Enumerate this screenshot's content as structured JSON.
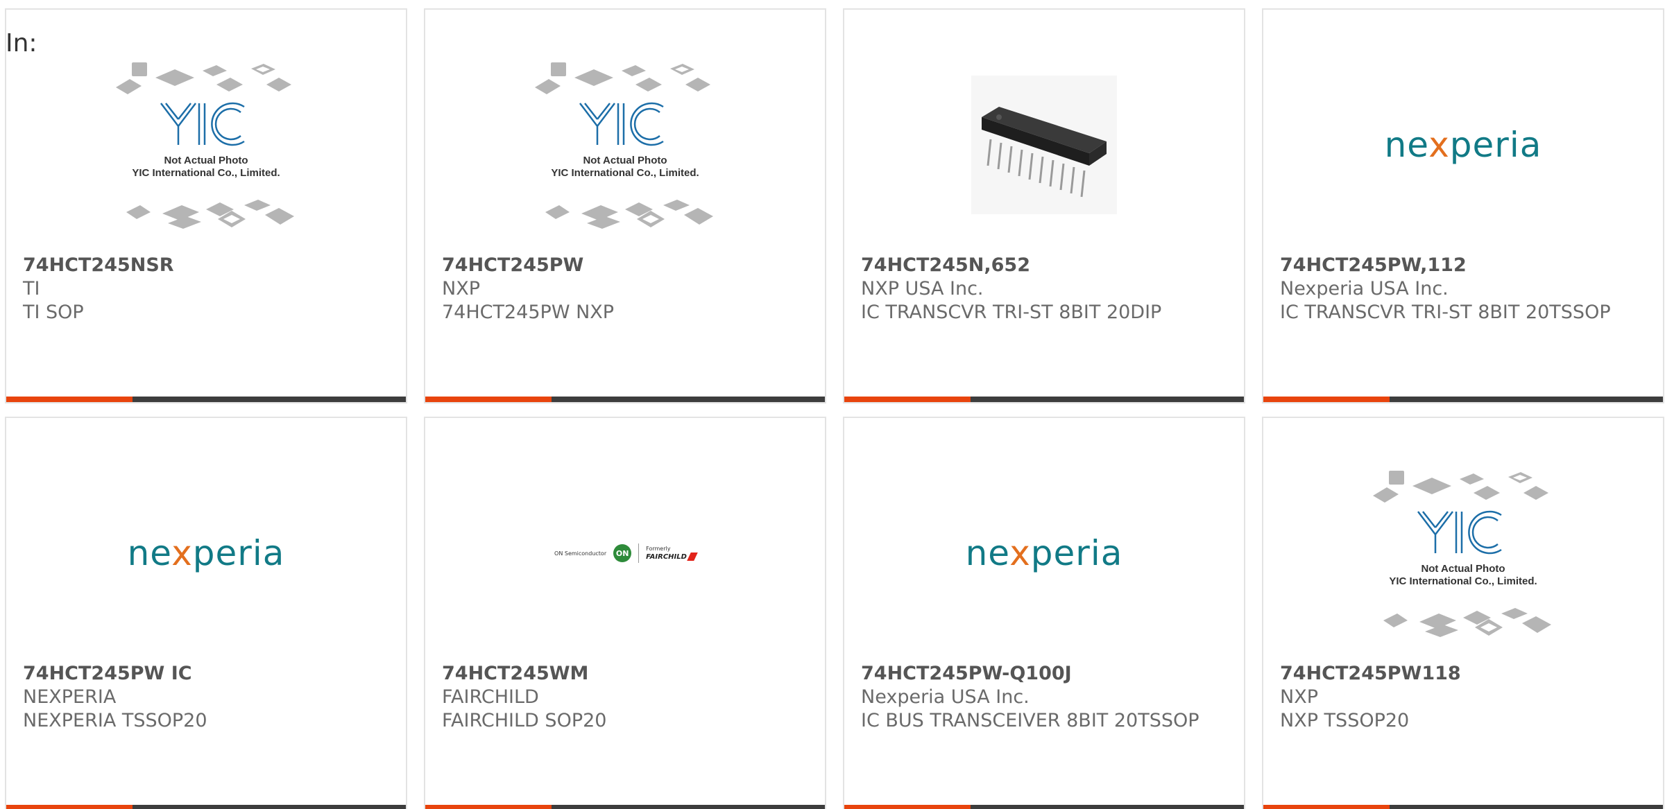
{
  "filter_label": "In:",
  "colors": {
    "card_border": "#e3e3e3",
    "bar_dark": "#3d3d3d",
    "bar_accent": "#e8440d",
    "nexperia_teal": "#117a86",
    "nexperia_orange": "#e36f1e"
  },
  "placeholder": {
    "line1": "Not Actual Photo",
    "line2": "YIC International Co., Limited.",
    "logo_text": "YIC"
  },
  "nexperia_logo": {
    "before": "ne",
    "x": "x",
    "after": "peria"
  },
  "fairchild_logo": {
    "on_semi": "ON Semiconductor",
    "on": "ON",
    "formerly": "Formerly",
    "fairchild": "FAIRCHILD"
  },
  "products": [
    {
      "part": "74HCT245NSR",
      "manufacturer": "TI",
      "description": "TI SOP",
      "image": "placeholder-icon"
    },
    {
      "part": "74HCT245PW",
      "manufacturer": "NXP",
      "description": "74HCT245PW NXP",
      "image": "placeholder-icon"
    },
    {
      "part": "74HCT245N,652",
      "manufacturer": "NXP USA Inc.",
      "description": "IC TRANSCVR TRI-ST 8BIT 20DIP",
      "image": "dip-chip-photo"
    },
    {
      "part": "74HCT245PW,112",
      "manufacturer": "Nexperia USA Inc.",
      "description": "IC TRANSCVR TRI-ST 8BIT 20TSSOP",
      "image": "nexperia-logo"
    },
    {
      "part": "74HCT245PW IC",
      "manufacturer": "NEXPERIA",
      "description": "NEXPERIA TSSOP20",
      "image": "nexperia-logo"
    },
    {
      "part": "74HCT245WM",
      "manufacturer": "FAIRCHILD",
      "description": "FAIRCHILD SOP20",
      "image": "fairchild-logo"
    },
    {
      "part": "74HCT245PW-Q100J",
      "manufacturer": "Nexperia USA Inc.",
      "description": "IC BUS TRANSCEIVER 8BIT 20TSSOP",
      "image": "nexperia-logo"
    },
    {
      "part": "74HCT245PW118",
      "manufacturer": "NXP",
      "description": "NXP TSSOP20",
      "image": "placeholder-icon"
    }
  ]
}
